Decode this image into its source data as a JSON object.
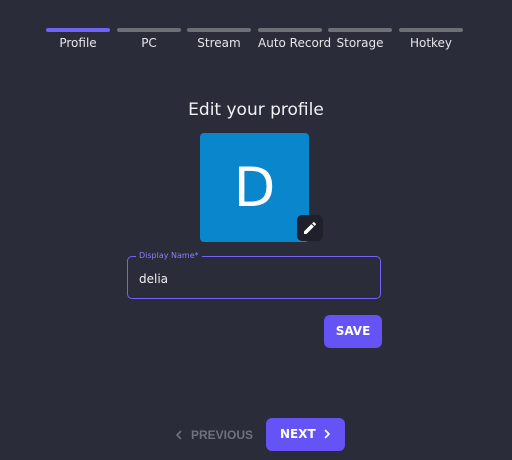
{
  "stepper": {
    "steps": [
      {
        "label": "Profile",
        "active": true
      },
      {
        "label": "PC",
        "active": false
      },
      {
        "label": "Stream",
        "active": false
      },
      {
        "label": "Auto Record",
        "active": false
      },
      {
        "label": "Storage",
        "active": false
      },
      {
        "label": "Hotkey",
        "active": false
      }
    ]
  },
  "profile": {
    "title": "Edit your profile",
    "avatar_initial": "D",
    "avatar_color": "#0a86cd",
    "edit_icon": "pencil-icon"
  },
  "display_name": {
    "label": "Display Name*",
    "value": "delia"
  },
  "actions": {
    "save_label": "SAVE",
    "previous_label": "PREVIOUS",
    "next_label": "NEXT"
  },
  "colors": {
    "accent": "#6553f5",
    "background": "#2a2c39"
  }
}
